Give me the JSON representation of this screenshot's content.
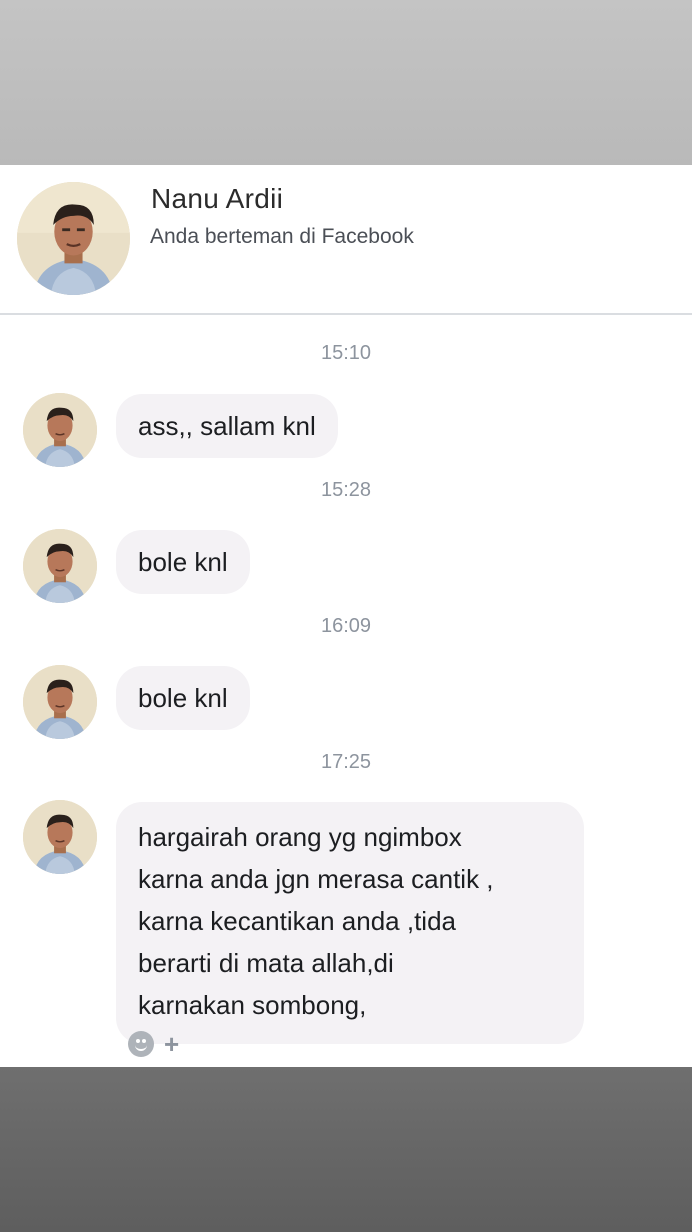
{
  "header": {
    "name": "Nanu Ardii",
    "subtitle": "Anda berteman di Facebook"
  },
  "messages": [
    {
      "time": "15:10",
      "text": "ass,, sallam knl"
    },
    {
      "time": "15:28",
      "text": "bole knl"
    },
    {
      "time": "16:09",
      "text": "bole knl"
    },
    {
      "time": "17:25",
      "text": "hargairah orang   yg ngimbox\nkarna anda jgn merasa cantik  ,\n karna kecantikan anda ,tida\nberarti di mata allah,di\nkarnakan sombong,"
    }
  ],
  "reactions": {
    "add_symbol": "+"
  },
  "colors": {
    "bubble": "#f4f2f5",
    "timestamp": "#8d949e",
    "top_band": "#c4c4c4",
    "bottom_band": "#6f6f6f"
  },
  "icons": [
    "profile-avatar",
    "smiley-icon",
    "plus-icon"
  ]
}
